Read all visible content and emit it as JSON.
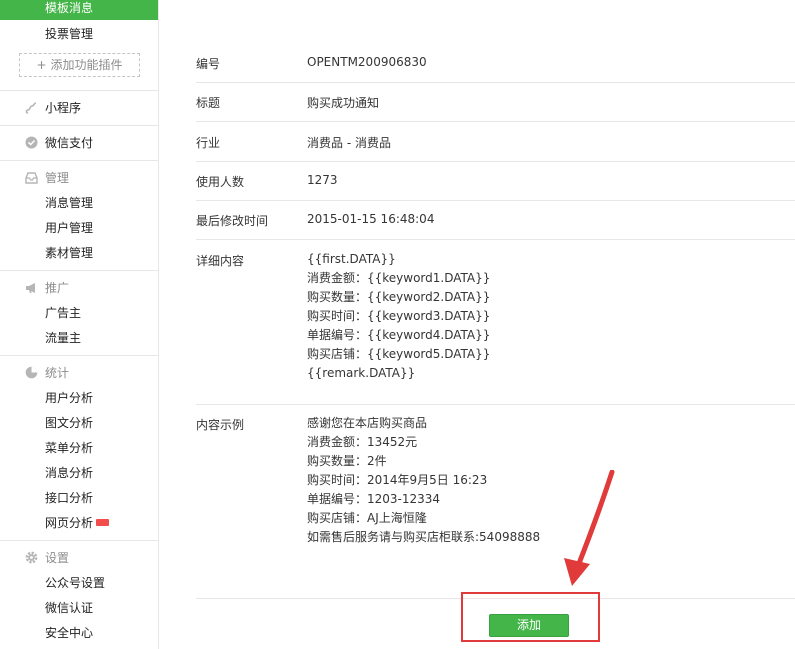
{
  "sidebar": {
    "active_item": "模板消息",
    "vote_item": "投票管理",
    "add_plugin": "添加功能插件",
    "mini_program": "小程序",
    "wechat_pay": "微信支付",
    "manage": {
      "title": "管理",
      "items": [
        "消息管理",
        "用户管理",
        "素材管理"
      ]
    },
    "promote": {
      "title": "推广",
      "items": [
        "广告主",
        "流量主"
      ]
    },
    "stats": {
      "title": "统计",
      "items": [
        "用户分析",
        "图文分析",
        "菜单分析",
        "消息分析",
        "接口分析",
        "网页分析"
      ]
    },
    "settings": {
      "title": "设置",
      "items": [
        "公众号设置",
        "微信认证",
        "安全中心"
      ]
    }
  },
  "details": {
    "id": {
      "label": "编号",
      "value": "OPENTM200906830"
    },
    "title": {
      "label": "标题",
      "value": "购买成功通知"
    },
    "industry": {
      "label": "行业",
      "value": "消费品 - 消费品"
    },
    "users": {
      "label": "使用人数",
      "value": "1273"
    },
    "modified": {
      "label": "最后修改时间",
      "value": "2015-01-15 16:48:04"
    },
    "content": {
      "label": "详细内容",
      "lines": [
        "{{first.DATA}}",
        "消费金额：{{keyword1.DATA}}",
        "购买数量：{{keyword2.DATA}}",
        "购买时间：{{keyword3.DATA}}",
        "单据编号：{{keyword4.DATA}}",
        "购买店铺：{{keyword5.DATA}}",
        "{{remark.DATA}}"
      ]
    },
    "example": {
      "label": "内容示例",
      "lines": [
        "感谢您在本店购买商品",
        "消费金额：13452元",
        "购买数量：2件",
        "购买时间：2014年9月5日 16:23",
        "单据编号：1203-12334",
        "购买店铺：AJ上海恒隆",
        "如需售后服务请与购买店柜联系:54098888"
      ]
    }
  },
  "add_button": "添加",
  "colors": {
    "accent": "#44b549",
    "highlight": "#e13a3a"
  }
}
